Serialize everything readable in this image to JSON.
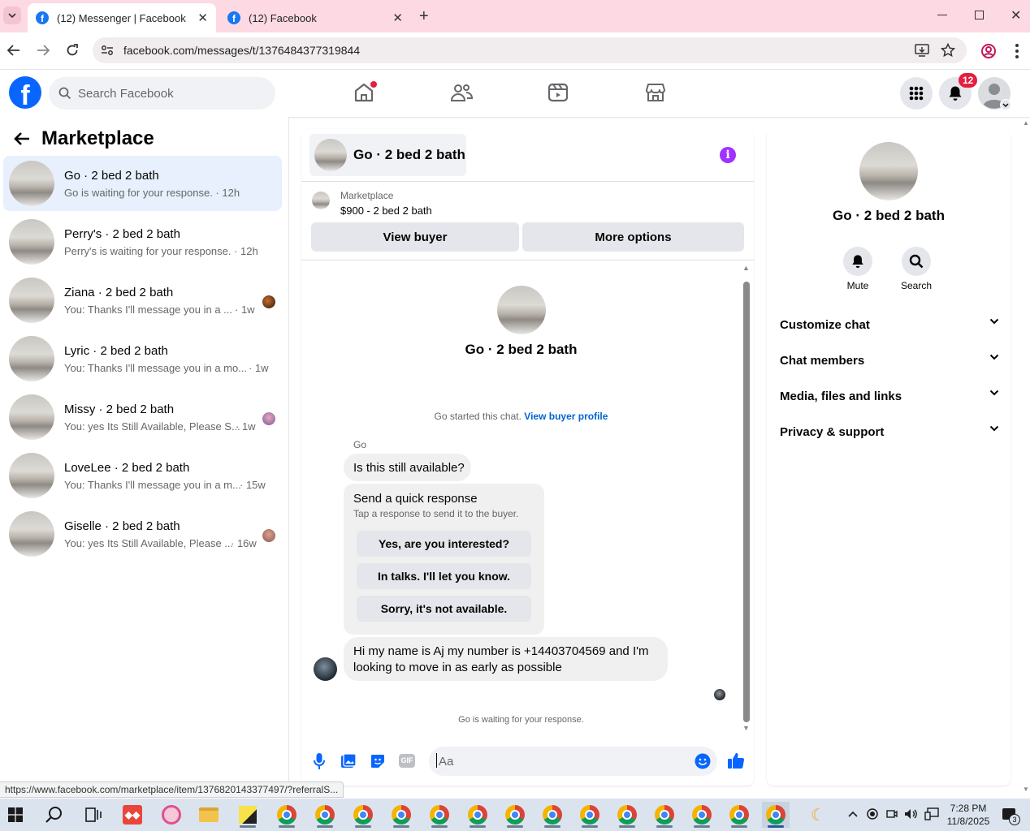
{
  "browser": {
    "tabs": [
      {
        "label": "(12) Messenger | Facebook",
        "active": true
      },
      {
        "label": "(12) Facebook",
        "active": false
      }
    ],
    "url": "facebook.com/messages/t/1376484377319844",
    "status_link": "https://www.facebook.com/marketplace/item/1376820143377497/?referralS..."
  },
  "header": {
    "search_placeholder": "Search Facebook",
    "notification_count": "12"
  },
  "sidebar": {
    "title": "Marketplace",
    "conversations": [
      {
        "name": "Go · 2 bed 2 bath",
        "preview": "Go is waiting for your response. · 12h",
        "time": "",
        "selected": true
      },
      {
        "name": "Perry's · 2 bed 2 bath",
        "preview": "Perry's is waiting for your response. · 12h",
        "time": "",
        "selected": false
      },
      {
        "name": "Ziana · 2 bed 2 bath",
        "preview": "You: Thanks I'll message you in a ...",
        "time": "· 1w",
        "selected": false
      },
      {
        "name": "Lyric · 2 bed 2 bath",
        "preview": "You: Thanks I'll message you in a mo...",
        "time": "· 1w",
        "selected": false
      },
      {
        "name": "Missy · 2 bed 2 bath",
        "preview": "You: yes Its Still Available, Please S...",
        "time": "· 1w",
        "selected": false
      },
      {
        "name": "LoveLee · 2 bed 2 bath",
        "preview": "You: Thanks I'll message you in a m...",
        "time": "· 15w",
        "selected": false
      },
      {
        "name": "Giselle · 2 bed 2 bath",
        "preview": "You: yes Its Still Available, Please ...",
        "time": "· 16w",
        "selected": false
      }
    ]
  },
  "chat": {
    "title": "Go · 2 bed 2 bath",
    "listing_source": "Marketplace",
    "listing_title": "$900 - 2 bed 2 bath",
    "view_buyer_label": "View buyer",
    "more_options_label": "More options",
    "profile_name": "Go · 2 bed 2 bath",
    "started_text": "Go started this chat.",
    "view_profile_link": "View buyer profile",
    "sender_name": "Go",
    "message_1": "Is this still available?",
    "quick_response_title": "Send a quick response",
    "quick_response_sub": "Tap a response to send it to the buyer.",
    "quick_responses": [
      "Yes, are you interested?",
      "In talks. I'll let you know.",
      "Sorry, it's not available."
    ],
    "message_2_line1": "Hi my name is Aj my number is +14403704569 and I'm",
    "message_2_line2": "looking to move in as early as possible",
    "waiting_text": "Go is waiting for your response.",
    "composer_placeholder": "Aa"
  },
  "details": {
    "name": "Go · 2 bed 2 bath",
    "mute_label": "Mute",
    "search_label": "Search",
    "sections": [
      "Customize chat",
      "Chat members",
      "Media, files and links",
      "Privacy & support"
    ]
  },
  "taskbar": {
    "time": "7:28 PM",
    "date": "11/8/2025",
    "notif_count": "3"
  },
  "colors": {
    "fb_blue": "#0866ff",
    "link_blue": "#0064d1",
    "selected_bg": "#e7f0fc",
    "notif_red": "#e41e3f",
    "info_purple": "#a033ff",
    "title_bar": "#fdd9e3"
  }
}
